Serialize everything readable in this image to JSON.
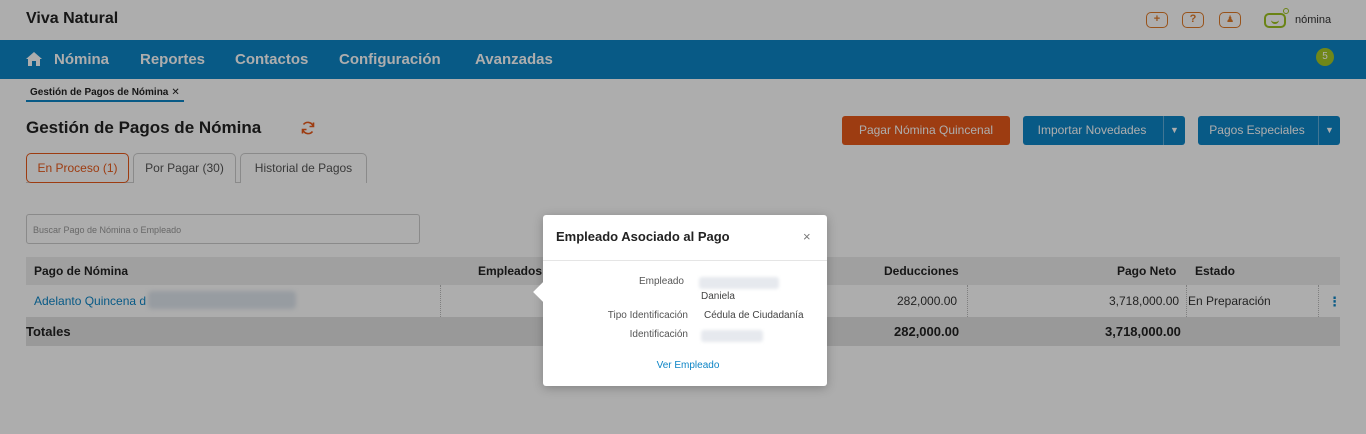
{
  "app": {
    "company": "Viva Natural",
    "brand": "nómina"
  },
  "top_icons": [
    "plus-icon",
    "help-icon",
    "user-icon"
  ],
  "top_icon_glyphs": {
    "plus": "+",
    "help": "?",
    "user": "♟"
  },
  "nav": {
    "items": [
      "Nómina",
      "Reportes",
      "Contactos",
      "Configuración",
      "Avanzadas"
    ],
    "badge": "5"
  },
  "breadcrumb": {
    "label": "Gestión de Pagos de Nómina",
    "close": "✕"
  },
  "page": {
    "title": "Gestión de Pagos de Nómina"
  },
  "actions": {
    "pay": "Pagar Nómina Quincenal",
    "import": "Importar Novedades",
    "special": "Pagos Especiales",
    "caret": "▼"
  },
  "tabs": [
    "En Proceso (1)",
    "Por Pagar (30)",
    "Historial de Pagos"
  ],
  "search": {
    "placeholder": "Buscar Pago de Nómina o Empleado"
  },
  "table": {
    "headers": {
      "payroll": "Pago de Nómina",
      "employees": "Empleados",
      "deductions": "Deducciones",
      "net": "Pago Neto",
      "status": "Estado"
    },
    "rows": [
      {
        "payroll": "Adelanto Quincena d",
        "deductions": "282,000.00",
        "net": "3,718,000.00",
        "status": "En Preparación",
        "menu": "⋮"
      }
    ],
    "totals": {
      "label": "Totales",
      "deductions": "282,000.00",
      "net": "3,718,000.00"
    }
  },
  "modal": {
    "title": "Empleado Asociado al Pago",
    "close": "×",
    "fields": {
      "employee_label": "Empleado",
      "employee_value": "Daniela",
      "id_type_label": "Tipo Identificación",
      "id_type_value": "Cédula de Ciudadanía",
      "id_label": "Identificación"
    },
    "link": "Ver Empleado"
  },
  "colors": {
    "primary": "#0d85c6",
    "accent": "#e8591a",
    "brand": "#a5c826"
  }
}
